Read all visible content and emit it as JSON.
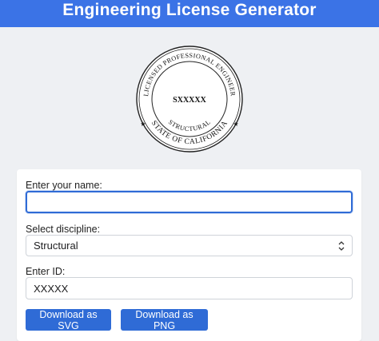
{
  "header": {
    "title": "Engineering License Generator"
  },
  "seal": {
    "top_text": "LICENSED PROFESSIONAL ENGINEER",
    "bottom_text": "STATE OF CALIFORNIA",
    "discipline_text": "STRUCTURAL",
    "id_text": "SXXXXX",
    "star": "★"
  },
  "form": {
    "name_label": "Enter your name:",
    "name_value": "",
    "discipline_label": "Select discipline:",
    "discipline_selected": "Structural",
    "id_label": "Enter ID:",
    "id_value": "XXXXX",
    "download_svg_label": "Download as SVG",
    "download_png_label": "Download as PNG"
  },
  "colors": {
    "accent": "#2f6bd6",
    "header_bg": "#3b73e6",
    "page_bg": "#eef0f3"
  }
}
